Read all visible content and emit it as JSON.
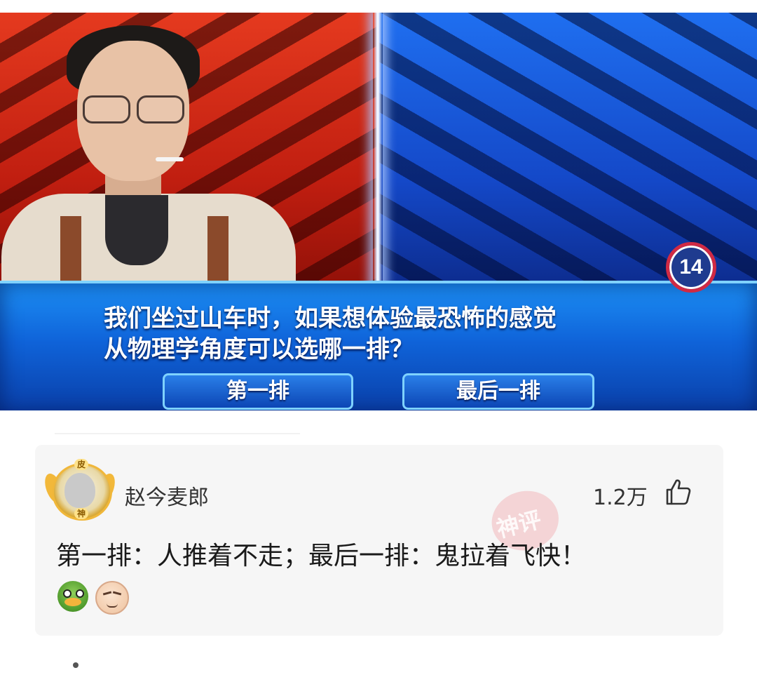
{
  "video": {
    "question_number": "14",
    "question_line1": "我们坐过山车时，如果想体验最恐怖的感觉",
    "question_line2": "从物理学角度可以选哪一排？",
    "option_a": "第一排",
    "option_b": "最后一排"
  },
  "comment": {
    "avatar_badge_top": "皮",
    "avatar_badge_bottom": "神",
    "username": "赵今麦郎",
    "likes": "1.2万",
    "stamp": "神评",
    "text": "第一排：人推着不走；最后一排：鬼拉着飞快！",
    "emojis": [
      "duck-emoji",
      "smirk-face-emoji"
    ]
  }
}
